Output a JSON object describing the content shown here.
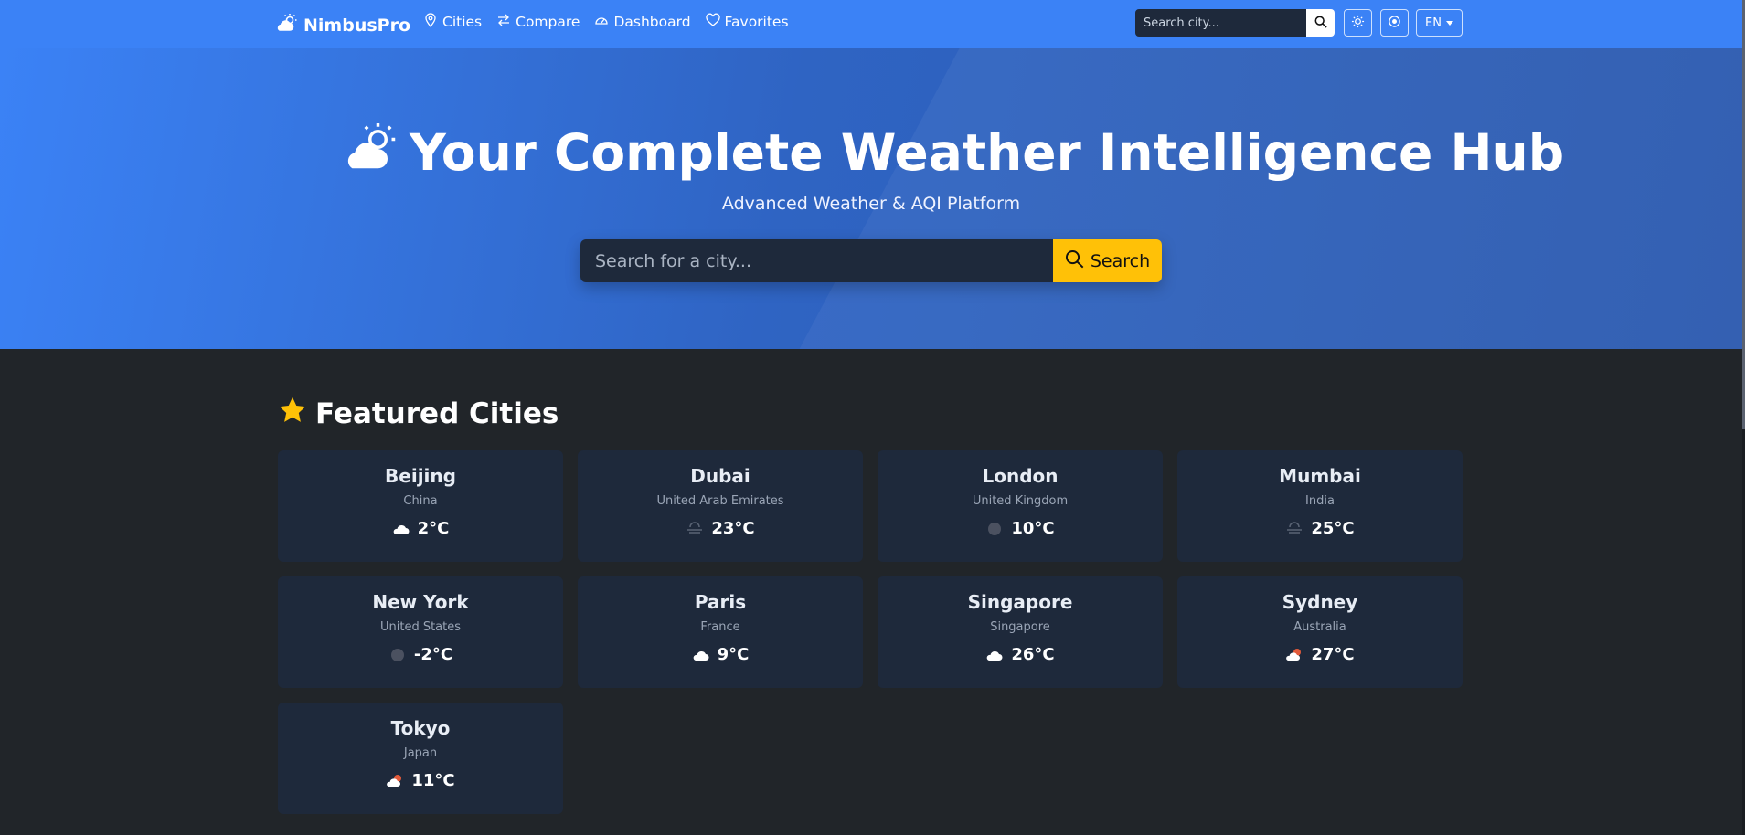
{
  "nav": {
    "brand": "NimbusPro",
    "links": [
      {
        "label": "Cities",
        "icon": "map-pin-icon"
      },
      {
        "label": "Compare",
        "icon": "arrows-left-right-icon"
      },
      {
        "label": "Dashboard",
        "icon": "speedometer-icon"
      },
      {
        "label": "Favorites",
        "icon": "heart-icon"
      }
    ],
    "search_placeholder": "Search city...",
    "language": "EN"
  },
  "hero": {
    "title": "Your Complete Weather Intelligence Hub",
    "subtitle": "Advanced Weather & AQI Platform",
    "search_placeholder": "Search for a city...",
    "search_label": "Search"
  },
  "featured": {
    "title": "Featured Cities",
    "cities": [
      {
        "name": "Beijing",
        "country": "China",
        "temp": "2°C",
        "icon": "cloud"
      },
      {
        "name": "Dubai",
        "country": "United Arab Emirates",
        "temp": "23°C",
        "icon": "haze"
      },
      {
        "name": "London",
        "country": "United Kingdom",
        "temp": "10°C",
        "icon": "dark-circle"
      },
      {
        "name": "Mumbai",
        "country": "India",
        "temp": "25°C",
        "icon": "haze"
      },
      {
        "name": "New York",
        "country": "United States",
        "temp": "-2°C",
        "icon": "dark-circle"
      },
      {
        "name": "Paris",
        "country": "France",
        "temp": "9°C",
        "icon": "cloud"
      },
      {
        "name": "Singapore",
        "country": "Singapore",
        "temp": "26°C",
        "icon": "cloud"
      },
      {
        "name": "Sydney",
        "country": "Australia",
        "temp": "27°C",
        "icon": "cloud-sun"
      },
      {
        "name": "Tokyo",
        "country": "Japan",
        "temp": "11°C",
        "icon": "cloud-sun"
      }
    ]
  },
  "colors": {
    "nav_bg": "#3b82f6",
    "page_bg": "#212529",
    "card_bg": "#1e293b",
    "accent": "#ffc107"
  }
}
